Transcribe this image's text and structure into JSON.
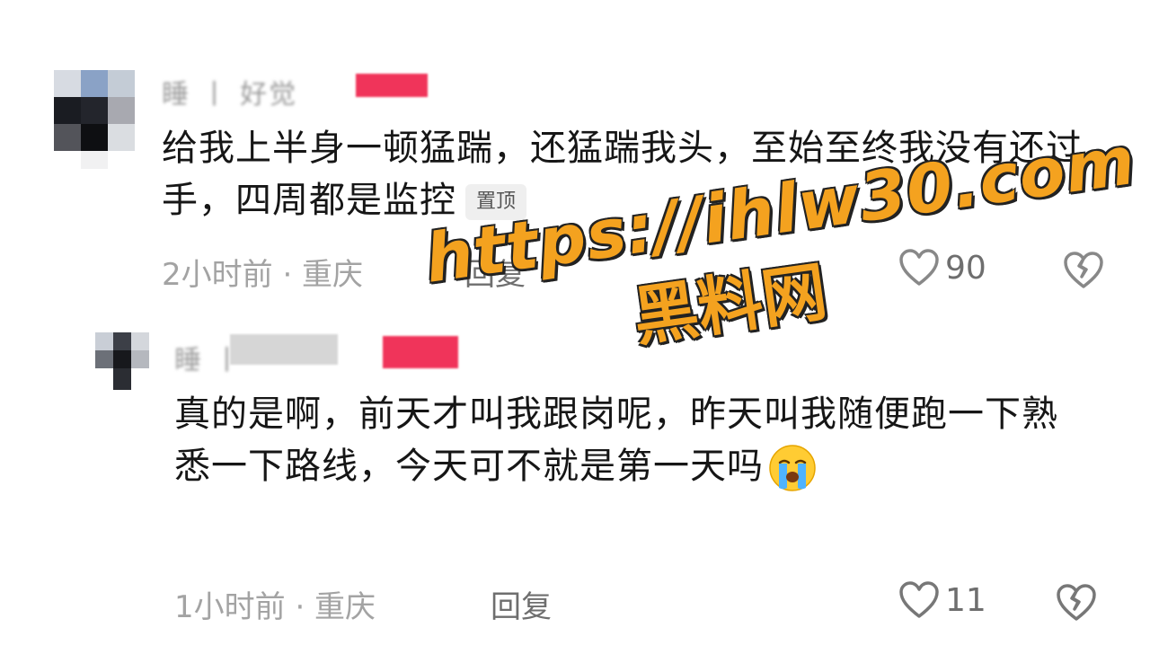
{
  "comments": [
    {
      "username": "睡 丨 好觉",
      "text": "给我上半身一顿猛踹，还猛踹我头，至始至终我没有还过手，四周都是监控",
      "pinned_label": "置顶",
      "time_location": "2小时前 · 重庆",
      "reply_label": "回复",
      "likes": "90"
    },
    {
      "username": "睡 丨",
      "text": "真的是啊，前天才叫我跟岗呢，昨天叫我随便跑一下熟悉一下路线，今天可不就是第一天吗",
      "emoji": "loudly-crying-face",
      "time_location": "1小时前 · 重庆",
      "reply_label": "回复",
      "likes": "11"
    }
  ],
  "watermark": {
    "url": "https://ihlw30.com",
    "name": "黑料网"
  },
  "colors": {
    "watermark": "#f4a21f",
    "tag": "#f0345a",
    "meta": "#a3a3a3"
  }
}
